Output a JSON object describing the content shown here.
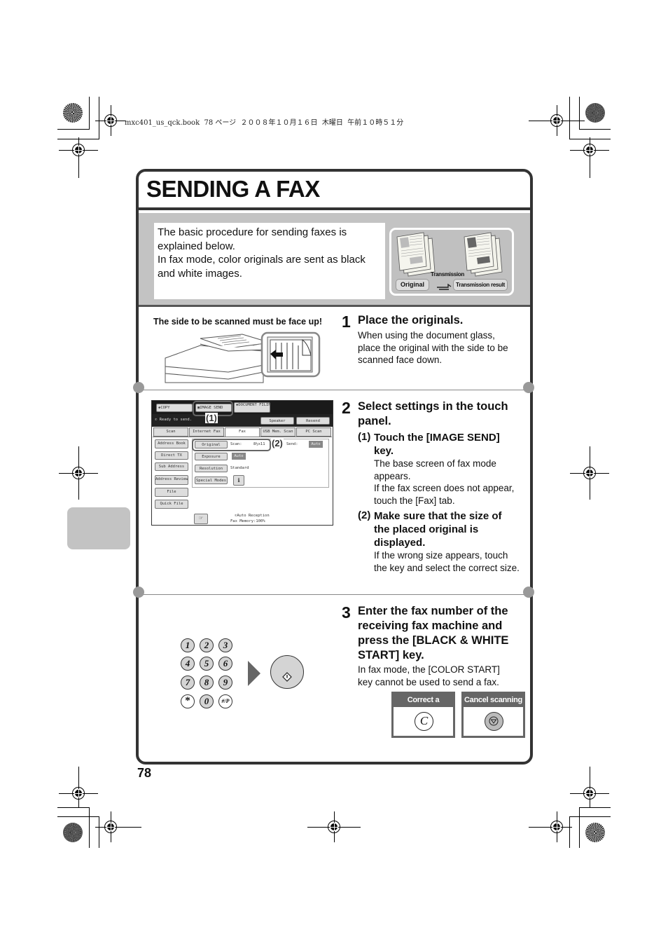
{
  "slug": "mxc401_us_qck.book  78 ページ  ２００８年１０月１６日  木曜日  午前１０時５１分",
  "page_title": "SENDING A FAX",
  "intro": {
    "lines": [
      "The basic procedure for sending faxes is",
      "explained below.",
      "In fax mode, color originals are sent as black",
      "and white images."
    ],
    "illustration": {
      "transmission_label": "Transmission",
      "original_label": "Original",
      "result_label": "Transmission result",
      "arrow_icon": "transmission-arrow-icon"
    }
  },
  "step1": {
    "number": "1",
    "heading": "Place the originals.",
    "body": [
      "When using the document glass,",
      "place the original with the side to be",
      "scanned face down."
    ],
    "image_caption": "The side to be scanned must be face up!"
  },
  "step2": {
    "number": "2",
    "heading": [
      "Select settings in the touch",
      "panel."
    ],
    "sub1": {
      "number": "(1)",
      "heading": [
        "Touch the [IMAGE SEND]",
        "key."
      ],
      "body": [
        "The base screen of fax mode",
        "appears.",
        "If the fax screen does not appear,",
        "touch the [Fax] tab."
      ]
    },
    "sub2": {
      "number": "(2)",
      "heading": [
        "Make sure that the size of",
        "the placed original is",
        "displayed."
      ],
      "body": [
        "If the wrong size appears, touch",
        "the key and select the correct size."
      ]
    },
    "panel": {
      "mode_tabs": [
        "COPY",
        "IMAGE SEND",
        "DOCUMENT FILING"
      ],
      "status": "Ready to send.",
      "speaker": "Speaker",
      "resend": "Resend",
      "tabs": [
        "Scan",
        "Internet Fax",
        "Fax",
        "USB Mem. Scan",
        "PC Scan"
      ],
      "active_tab": "Fax",
      "left_buttons": [
        "Address Book",
        "Direct TX",
        "Sub Address",
        "Address Review",
        "File",
        "Quick File"
      ],
      "settings": {
        "original_label": "Original",
        "scan_label": "Scan:",
        "scan_value": "8½x11",
        "send_label": "Send:",
        "send_value": "Auto",
        "exposure_label": "Exposure",
        "exposure_value": "Auto",
        "resolution_label": "Resolution",
        "resolution_value": "Standard",
        "special_modes_label": "Special Modes"
      },
      "footer_line1": "Auto Reception",
      "footer_line2": "Fax Memory:100%",
      "callout1": "(1)",
      "callout2": "(2)"
    }
  },
  "step3": {
    "number": "3",
    "heading": [
      "Enter the fax number of the",
      "receiving fax machine and",
      "press the [BLACK & WHITE",
      "START] key."
    ],
    "body": [
      "In fax mode, the [COLOR START]",
      "key cannot be used to send a fax."
    ],
    "keypad": [
      "1",
      "2",
      "3",
      "4",
      "5",
      "6",
      "7",
      "8",
      "9",
      "*",
      "0",
      "#/P"
    ],
    "correct_mistake": {
      "label": "Correct a mistake",
      "key": "C"
    },
    "cancel_scanning": {
      "label": "Cancel scanning"
    }
  },
  "page_number": "78"
}
